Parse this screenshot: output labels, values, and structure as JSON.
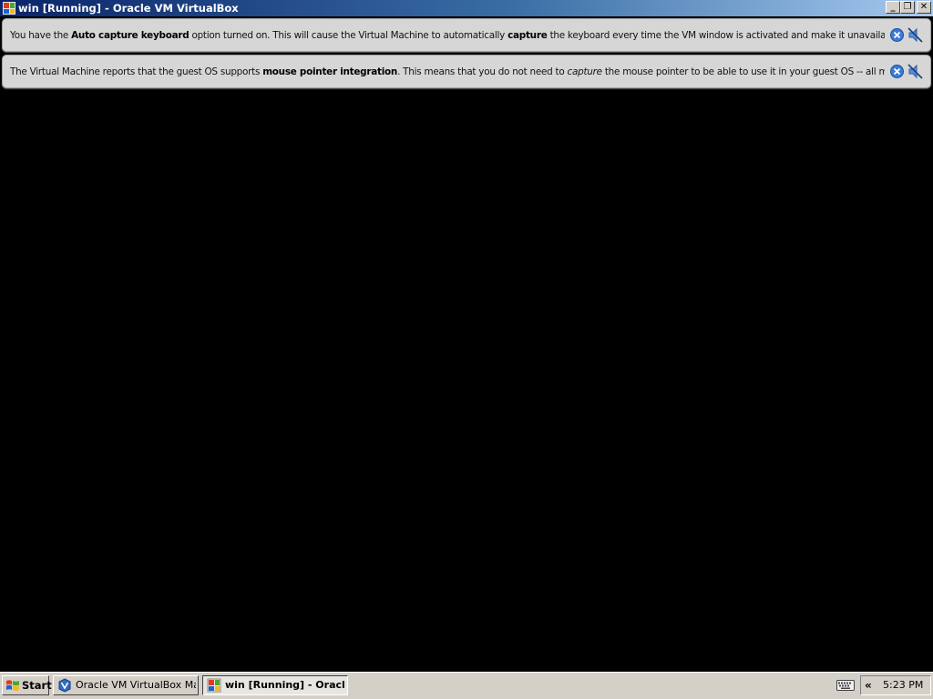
{
  "window": {
    "title": "win [Running] - Oracle VM VirtualBox",
    "min_glyph": "_",
    "max_glyph": "❐",
    "close_glyph": "✕"
  },
  "banners": [
    {
      "segments": [
        {
          "text": "You have the ",
          "style": "normal"
        },
        {
          "text": "Auto capture keyboard",
          "style": "bold"
        },
        {
          "text": " option turned on. This will cause the Virtual Machine to automatically ",
          "style": "normal"
        },
        {
          "text": "capture",
          "style": "bold"
        },
        {
          "text": " the keyboard every time the VM window is activated and make it unavailable to",
          "style": "normal"
        }
      ],
      "close_icon": "close-circle-icon",
      "dismiss_icon": "do-not-show-again-icon"
    },
    {
      "segments": [
        {
          "text": "The Virtual Machine reports that the guest OS supports ",
          "style": "normal"
        },
        {
          "text": "mouse pointer integration",
          "style": "bold"
        },
        {
          "text": ". This means that you do not need to ",
          "style": "normal"
        },
        {
          "text": "capture",
          "style": "italic"
        },
        {
          "text": " the mouse pointer to be able to use it in your guest OS -- all mouse",
          "style": "normal"
        }
      ],
      "close_icon": "close-circle-icon",
      "dismiss_icon": "do-not-show-again-icon"
    }
  ],
  "taskbar": {
    "start_label": "Start",
    "tasks": [
      {
        "label": "Oracle VM VirtualBox Ma...",
        "icon": "virtualbox-icon",
        "active": false
      },
      {
        "label": "win [Running] - Oracl...",
        "icon": "windows-vm-icon",
        "active": true
      }
    ],
    "tray_chevron": "«",
    "clock": "5:23 PM"
  },
  "colors": {
    "titlebar_start": "#0a246a",
    "titlebar_end": "#a6caf0",
    "banner_bg": "#d6d6d6",
    "vm_background": "#000000",
    "taskbar_bg": "#d4d0c8"
  }
}
